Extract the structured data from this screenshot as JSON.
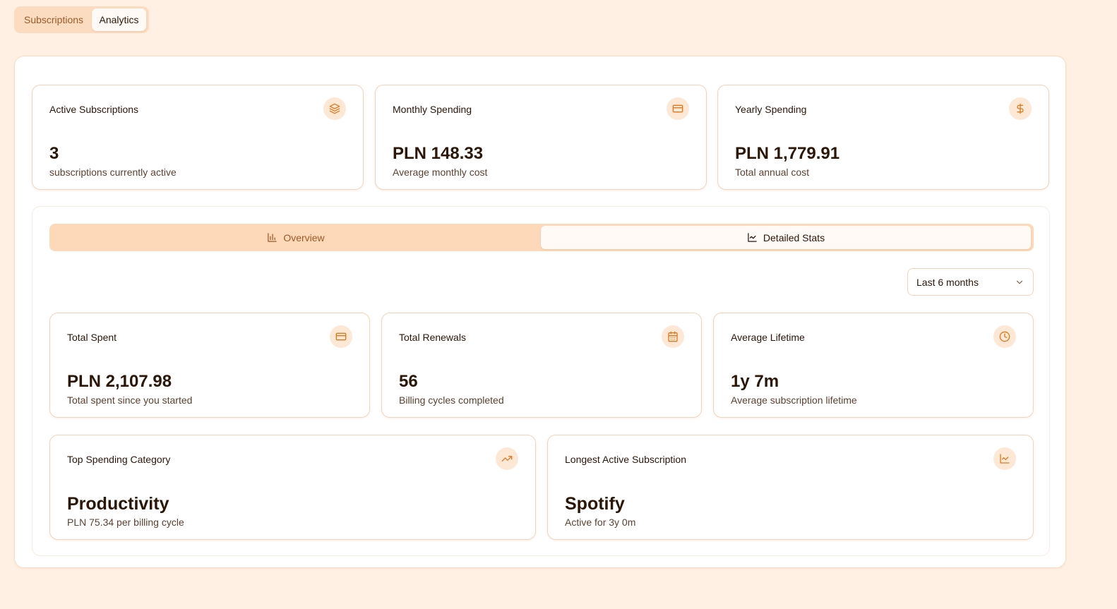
{
  "top_tabs": {
    "subscriptions": "Subscriptions",
    "analytics": "Analytics",
    "active": "Analytics"
  },
  "summary": [
    {
      "title": "Active Subscriptions",
      "value": "3",
      "caption": "subscriptions currently active",
      "icon": "layers-icon"
    },
    {
      "title": "Monthly Spending",
      "value": "PLN 148.33",
      "caption": "Average monthly cost",
      "icon": "credit-card-icon"
    },
    {
      "title": "Yearly Spending",
      "value": "PLN 1,779.91",
      "caption": "Total annual cost",
      "icon": "dollar-icon"
    }
  ],
  "view_tabs": {
    "overview": "Overview",
    "detailed": "Detailed Stats",
    "active": "Detailed Stats"
  },
  "period_select": {
    "value": "Last 6 months"
  },
  "stats": [
    {
      "title": "Total Spent",
      "value": "PLN 2,107.98",
      "caption": "Total spent since you started",
      "icon": "credit-card-icon"
    },
    {
      "title": "Total Renewals",
      "value": "56",
      "caption": "Billing cycles completed",
      "icon": "calendar-icon"
    },
    {
      "title": "Average Lifetime",
      "value": "1y 7m",
      "caption": "Average subscription lifetime",
      "icon": "clock-icon"
    }
  ],
  "highlights": [
    {
      "title": "Top Spending Category",
      "value": "Productivity",
      "caption": "PLN 75.34 per billing cycle",
      "icon": "trending-up-icon"
    },
    {
      "title": "Longest Active Subscription",
      "value": "Spotify",
      "caption": "Active for 3y 0m",
      "icon": "line-chart-icon"
    }
  ],
  "colors": {
    "page_bg": "#fff0e3",
    "accent": "#e07a1f",
    "icon_bg": "#fde8d6",
    "tab_bar": "#fdd9b9"
  }
}
